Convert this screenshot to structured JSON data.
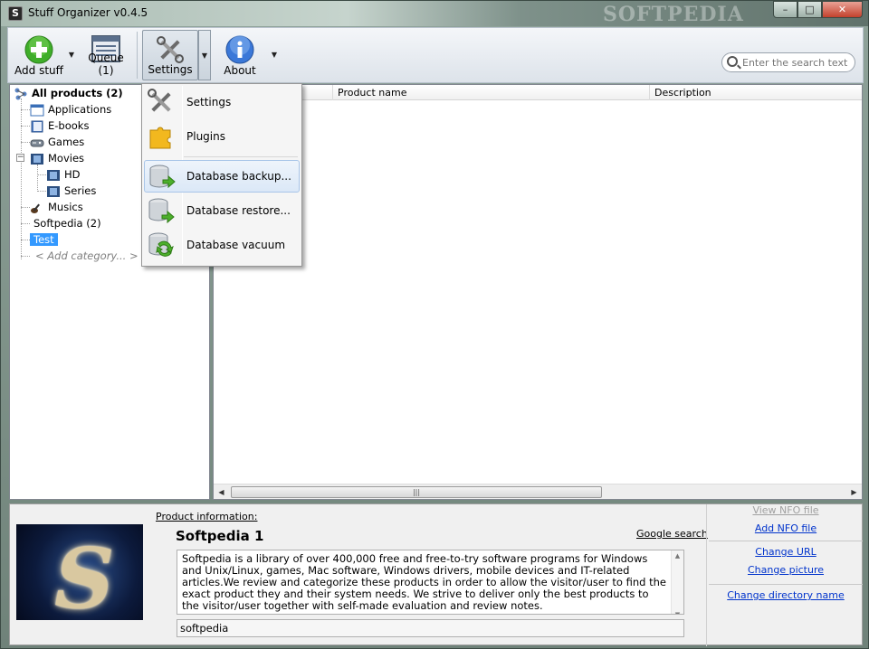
{
  "window": {
    "title": "Stuff Organizer v0.4.5",
    "app_icon_letter": "S",
    "watermark": "SOFTPEDIA",
    "controls": {
      "minimize": "–",
      "maximize": "□",
      "close": "✕"
    }
  },
  "toolbar": {
    "add_stuff": "Add stuff",
    "queue": "Queue (1)",
    "settings": "Settings",
    "about": "About",
    "dropdown_glyph": "▼"
  },
  "search": {
    "placeholder": "Enter the search text"
  },
  "tree": {
    "root": "All products (2)",
    "items": {
      "applications": "Applications",
      "ebooks": "E-books",
      "games": "Games",
      "movies": "Movies",
      "hd": "HD",
      "series": "Series",
      "musics": "Musics",
      "softpedia": "Softpedia (2)",
      "test": "Test",
      "add_category": "< Add category... >"
    }
  },
  "list": {
    "columns": [
      "Product name",
      "Description"
    ],
    "scroll_grip": "|||",
    "scroll_left": "◀",
    "scroll_right": "▶"
  },
  "settings_menu": {
    "items": [
      "Settings",
      "Plugins",
      "Database backup...",
      "Database restore...",
      "Database vacuum"
    ],
    "hovered": "Database backup..."
  },
  "details": {
    "label": "Product information:",
    "name": "Softpedia 1",
    "google_search": "Google search",
    "description": "Softpedia is a library of over 400,000 free and free-to-try software programs for Windows and Unix/Linux, games, Mac software, Windows drivers, mobile devices and IT-related articles.We review and categorize these products in order to allow the visitor/user to find the exact product they and their system needs. We strive to deliver only the best products to the visitor/user together with self-made evaluation and review notes.",
    "tags": "softpedia",
    "links": {
      "view_nfo": "View NFO file",
      "add_nfo": "Add NFO file",
      "change_url": "Change URL",
      "change_picture": "Change picture",
      "change_directory": "Change directory name"
    }
  },
  "colors": {
    "selection": "#3399ff",
    "link": "#0033cc",
    "close_button": "#c4412c"
  }
}
